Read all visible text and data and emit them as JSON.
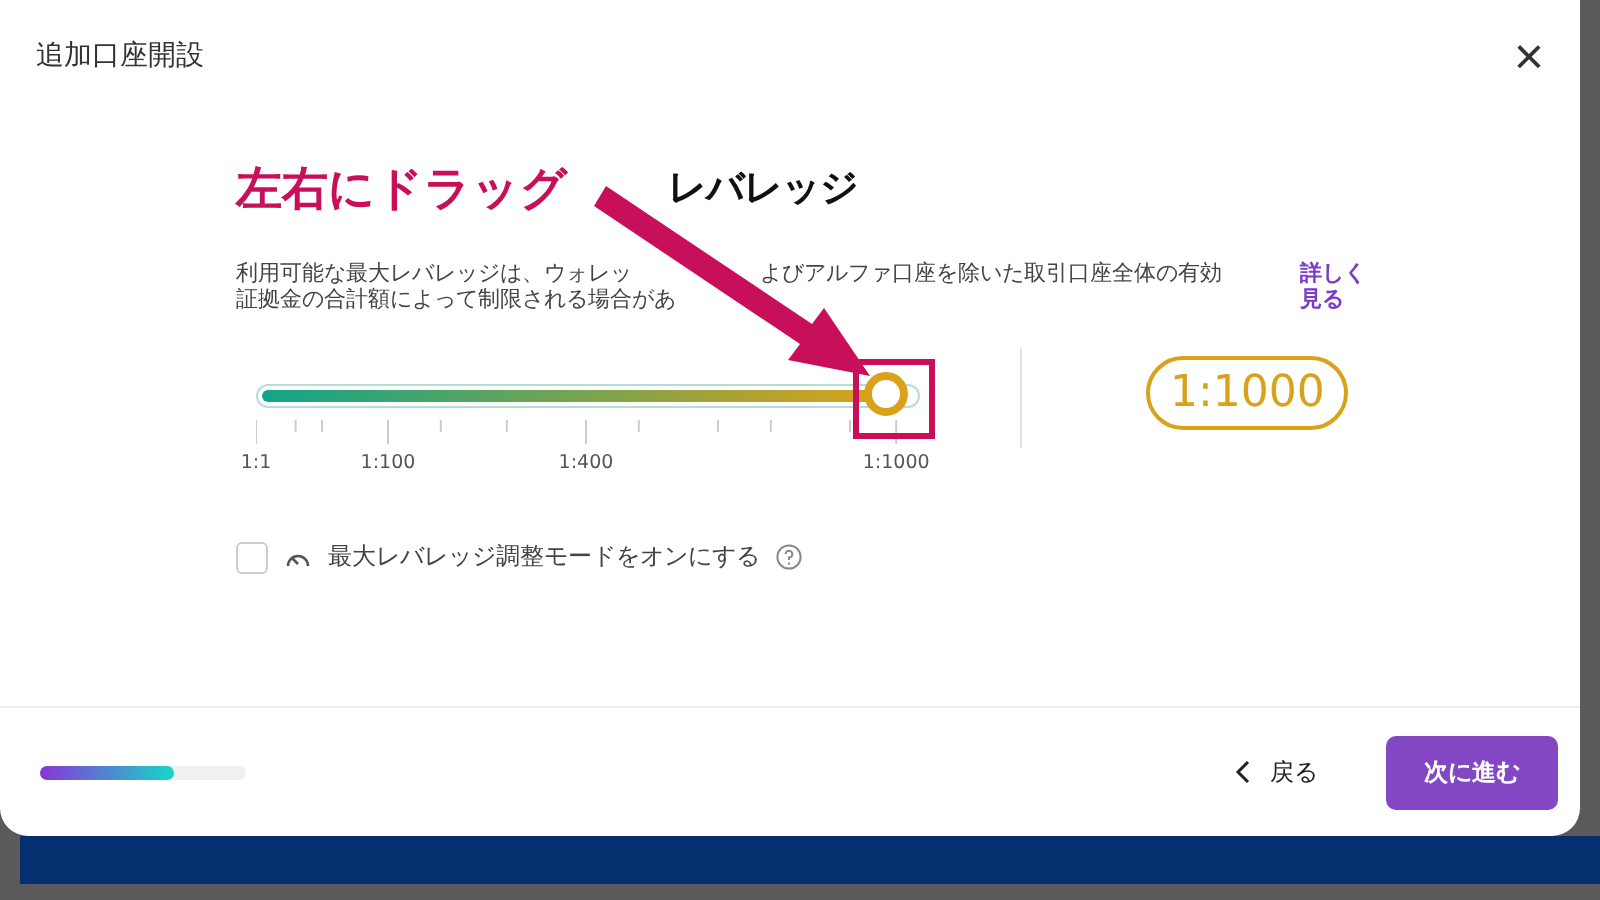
{
  "dialog": {
    "title": "追加口座開設",
    "close": "×"
  },
  "annotation": {
    "text": "左右にドラッグ"
  },
  "heading": "レバレッジ",
  "description": {
    "parts": [
      "利用可能な最大レバレッジは、ウォレッ",
      "よびアルファ口座を除いた取引口座全体の有効",
      "証拠金の合計額によって制限される場合があ"
    ],
    "link": "詳しく見る"
  },
  "slider": {
    "level": 0.95,
    "labels": [
      "1:1",
      "1:100",
      "1:400",
      "1:1000"
    ],
    "value": "1:1000"
  },
  "option": {
    "label": "最大レバレッジ調整モードをオンにする",
    "checked": false
  },
  "footer": {
    "progress": {
      "level": 0.65
    },
    "back": "戻る",
    "next": "次に進む"
  }
}
